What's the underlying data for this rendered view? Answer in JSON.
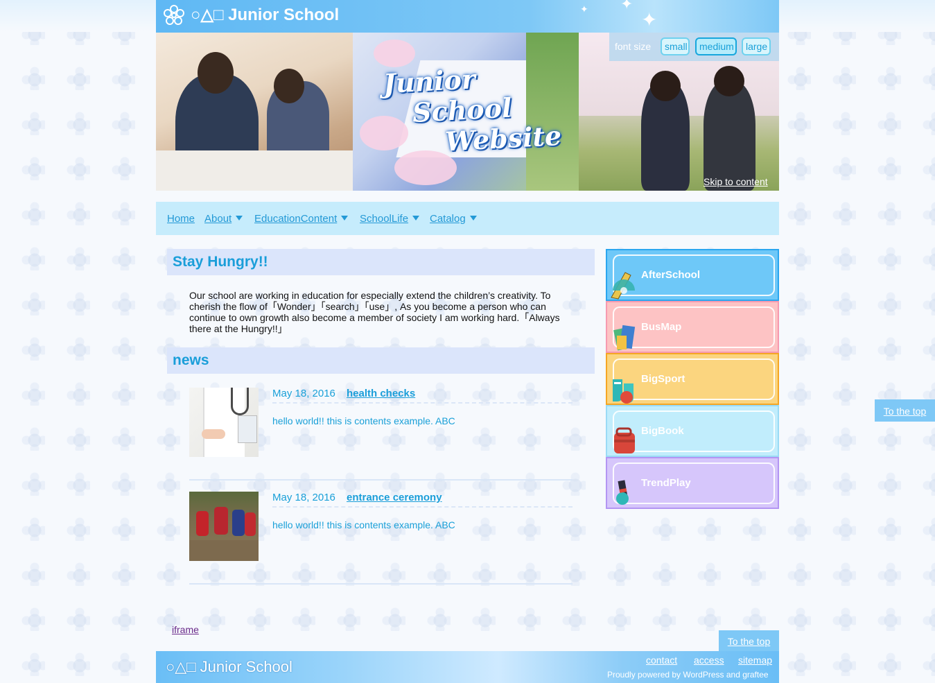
{
  "header": {
    "title": "○△□ Junior School"
  },
  "hero": {
    "script_lines": [
      "Junior",
      "School",
      "Website"
    ],
    "skip_link": "Skip to content"
  },
  "font_size": {
    "label": "font size",
    "options": [
      "small",
      "medium",
      "large"
    ],
    "selected": "medium"
  },
  "nav": {
    "items": [
      {
        "label": "Home",
        "dropdown": false
      },
      {
        "label": "About",
        "dropdown": true
      },
      {
        "label": "EducationContent",
        "dropdown": true
      },
      {
        "label": "SchoolLife",
        "dropdown": true
      },
      {
        "label": "Catalog",
        "dropdown": true
      }
    ]
  },
  "intro": {
    "heading": "Stay Hungry!!",
    "text": "Our school are working in education for especially extend the children’s creativity. To cherish the flow of「Wonder」「search」「use」, As you become a person who can continue to own growth also become a member of society I am working hard.「Always there at the Hungry!!」"
  },
  "news": {
    "heading": "news",
    "items": [
      {
        "date": "May 18, 2016",
        "title": "health checks",
        "text": "hello world!! this is contents example. ABC",
        "thumb_icon": "doctor-photo"
      },
      {
        "date": "May 18, 2016",
        "title": "entrance ceremony",
        "text": "hello world!! this is contents example. ABC",
        "thumb_icon": "rice-planting-photo"
      }
    ]
  },
  "sidebar": {
    "buttons": [
      {
        "label": "AfterSchool",
        "bg": "#6ec8f8",
        "border": "#2aa6ef",
        "icon": "ruler-protractor-icon"
      },
      {
        "label": "BusMap",
        "bg": "#fdc3c4",
        "border": "#f69ab0",
        "icon": "notebooks-icon"
      },
      {
        "label": "BigSport",
        "bg": "#fbd57f",
        "border": "#f5a623",
        "icon": "shoes-icon"
      },
      {
        "label": "BigBook",
        "bg": "#c1edfc",
        "border": "#9adbf5",
        "icon": "school-bag-icon"
      },
      {
        "label": "TrendPlay",
        "bg": "#d6c6fb",
        "border": "#b395f3",
        "icon": "pen-icon"
      }
    ]
  },
  "footer": {
    "iframe_link": "iframe",
    "to_top": "To the top",
    "title": "○△□ Junior School",
    "links": [
      "contact",
      "access",
      "sitemap"
    ],
    "powered": "Proudly powered by WordPress and graftee"
  },
  "colors": {
    "accent": "#1a9ed9",
    "nav_bg": "#c6ecfc",
    "header_bg": "#7ec8f6"
  }
}
